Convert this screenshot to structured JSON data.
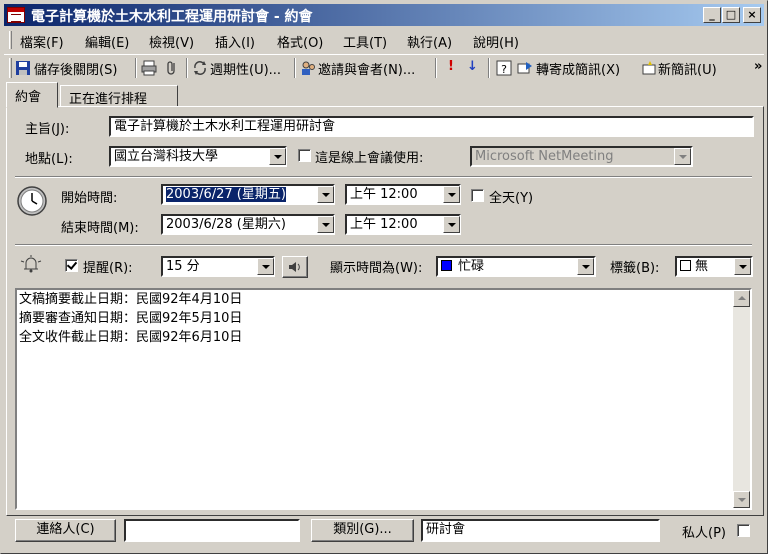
{
  "window": {
    "title": "電子計算機於土木水利工程運用研討會 - 約會",
    "minimize": "_",
    "maximize": "□",
    "close": "×"
  },
  "menu": [
    "檔案(F)",
    "編輯(E)",
    "檢視(V)",
    "插入(I)",
    "格式(O)",
    "工具(T)",
    "執行(A)",
    "說明(H)"
  ],
  "toolbar": {
    "save_close": "儲存後關閉(S)",
    "recurrence": "週期性(U)...",
    "invite": "邀請與會者(N)...",
    "forward": "轉寄成簡訊(X)",
    "new_message": "新簡訊(U)",
    "more": "»"
  },
  "tabs": [
    "約會",
    "正在進行排程"
  ],
  "form": {
    "subject_label": "主旨(J):",
    "subject_value": "電子計算機於土木水利工程運用研討會",
    "location_label": "地點(L):",
    "location_value": "國立台灣科技大學",
    "online_label": "這是線上會議使用:",
    "online_value": "Microsoft NetMeeting",
    "start_label": "開始時間:",
    "start_date": "2003/6/27 (星期五)",
    "start_time": "上午 12:00",
    "allday_label": "全天(Y)",
    "end_label": "結束時間(M):",
    "end_date": "2003/6/28 (星期六)",
    "end_time": "上午 12:00",
    "reminder_label": "提醒(R):",
    "reminder_value": "15 分",
    "show_as_label": "顯示時間為(W):",
    "show_as_value": "忙碌",
    "show_as_color": "#0000ff",
    "label_label": "標籤(B):",
    "label_value": "無"
  },
  "notes": [
    "文稿摘要截止日期：民國92年4月10日",
    "摘要審查通知日期：民國92年5月10日",
    "全文收件截止日期：民國92年6月10日"
  ],
  "footer": {
    "contacts_button": "連絡人(C)",
    "contacts_value": "",
    "categories_button": "類別(G)...",
    "categories_value": "研討會",
    "private_label": "私人(P)"
  }
}
